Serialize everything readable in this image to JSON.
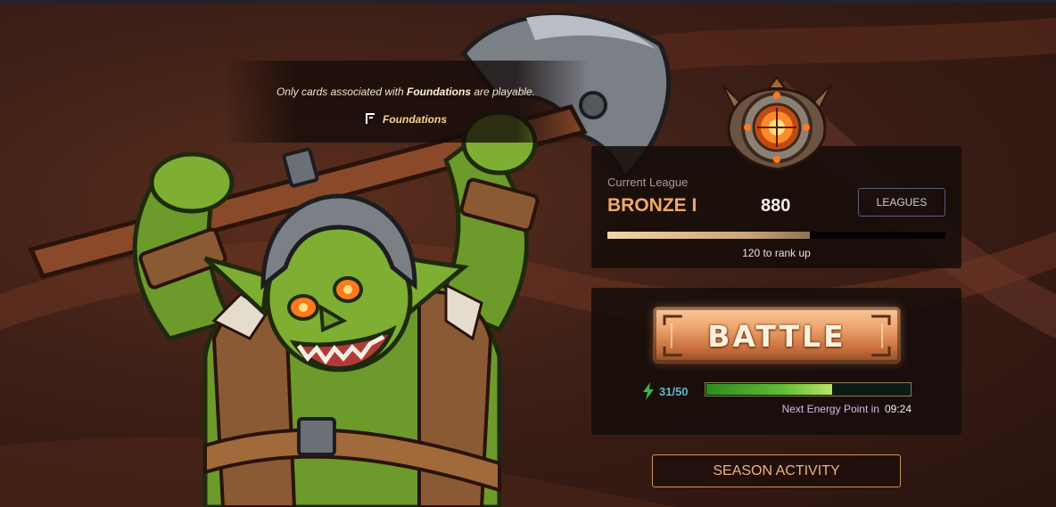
{
  "format": {
    "note_prefix": "Only cards associated with ",
    "note_bold": "Foundations",
    "note_suffix": " are playable.",
    "name": "Foundations",
    "icon": "foundations-logo-icon"
  },
  "league": {
    "label": "Current League",
    "name": "BRONZE I",
    "rating": "880",
    "leagues_button": "LEAGUES",
    "rank_progress": 0.6,
    "rank_up_text": "120 to rank up",
    "medal_icon": "bronze-league-medal-icon"
  },
  "battle": {
    "button_label": "BATTLE",
    "energy_icon": "lightning-bolt-icon",
    "energy_count": "31/50",
    "energy_progress": 0.62,
    "next_energy_label": "Next Energy Point in",
    "next_energy_time": "09:24"
  },
  "season": {
    "button_label": "SEASON ACTIVITY"
  },
  "art": {
    "character": "goblin-warrior-with-axe",
    "accent_color": "#f0a964",
    "energy_color": "#5fbc33"
  }
}
